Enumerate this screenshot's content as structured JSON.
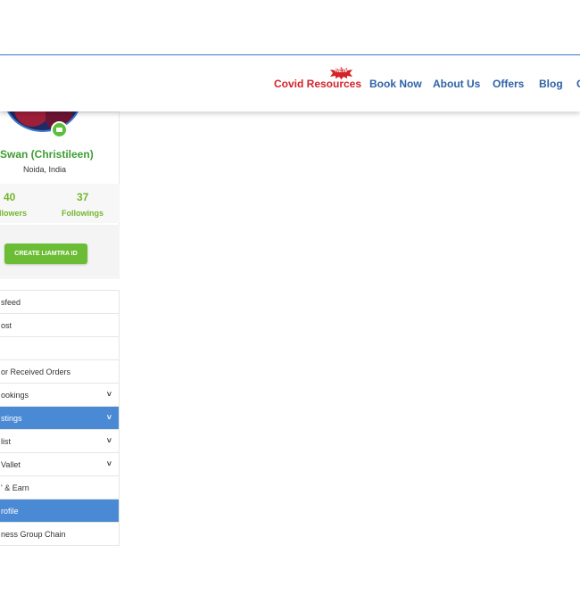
{
  "nav": {
    "items": [
      {
        "label": "Covid Resources",
        "badge": "NEW"
      },
      {
        "label": "Book Now"
      },
      {
        "label": "About Us"
      },
      {
        "label": "Offers"
      },
      {
        "label": "Blog"
      },
      {
        "label": "C"
      }
    ]
  },
  "profile": {
    "name": "Swan (Christileen)",
    "location": "Noida, India",
    "followers_count": "40",
    "followers_label": "llowers",
    "followings_count": "37",
    "followings_label": "Followings",
    "cta_label": "CREATE LIAMTRA ID"
  },
  "menu": {
    "items": [
      {
        "label": "sfeed",
        "chevron": false,
        "active": false
      },
      {
        "label": "ost",
        "chevron": false,
        "active": false
      },
      {
        "label": "",
        "chevron": false,
        "active": false
      },
      {
        "label": "or Received Orders",
        "chevron": false,
        "active": false
      },
      {
        "label": "ookings",
        "chevron": true,
        "active": false
      },
      {
        "label": "stings",
        "chevron": true,
        "active": true
      },
      {
        "label": "list",
        "chevron": true,
        "active": false
      },
      {
        "label": "Vallet",
        "chevron": true,
        "active": false
      },
      {
        "label": "' & Earn",
        "chevron": false,
        "active": false
      },
      {
        "label": "rofile",
        "chevron": false,
        "active": true
      },
      {
        "label": "ness Group Chain",
        "chevron": false,
        "active": false
      }
    ],
    "chevron_glyph": "˅"
  },
  "colors": {
    "accent_blue": "#4a89d3",
    "nav_blue": "#2f62a6",
    "covid_red": "#d3242a",
    "green": "#6cbd36"
  }
}
